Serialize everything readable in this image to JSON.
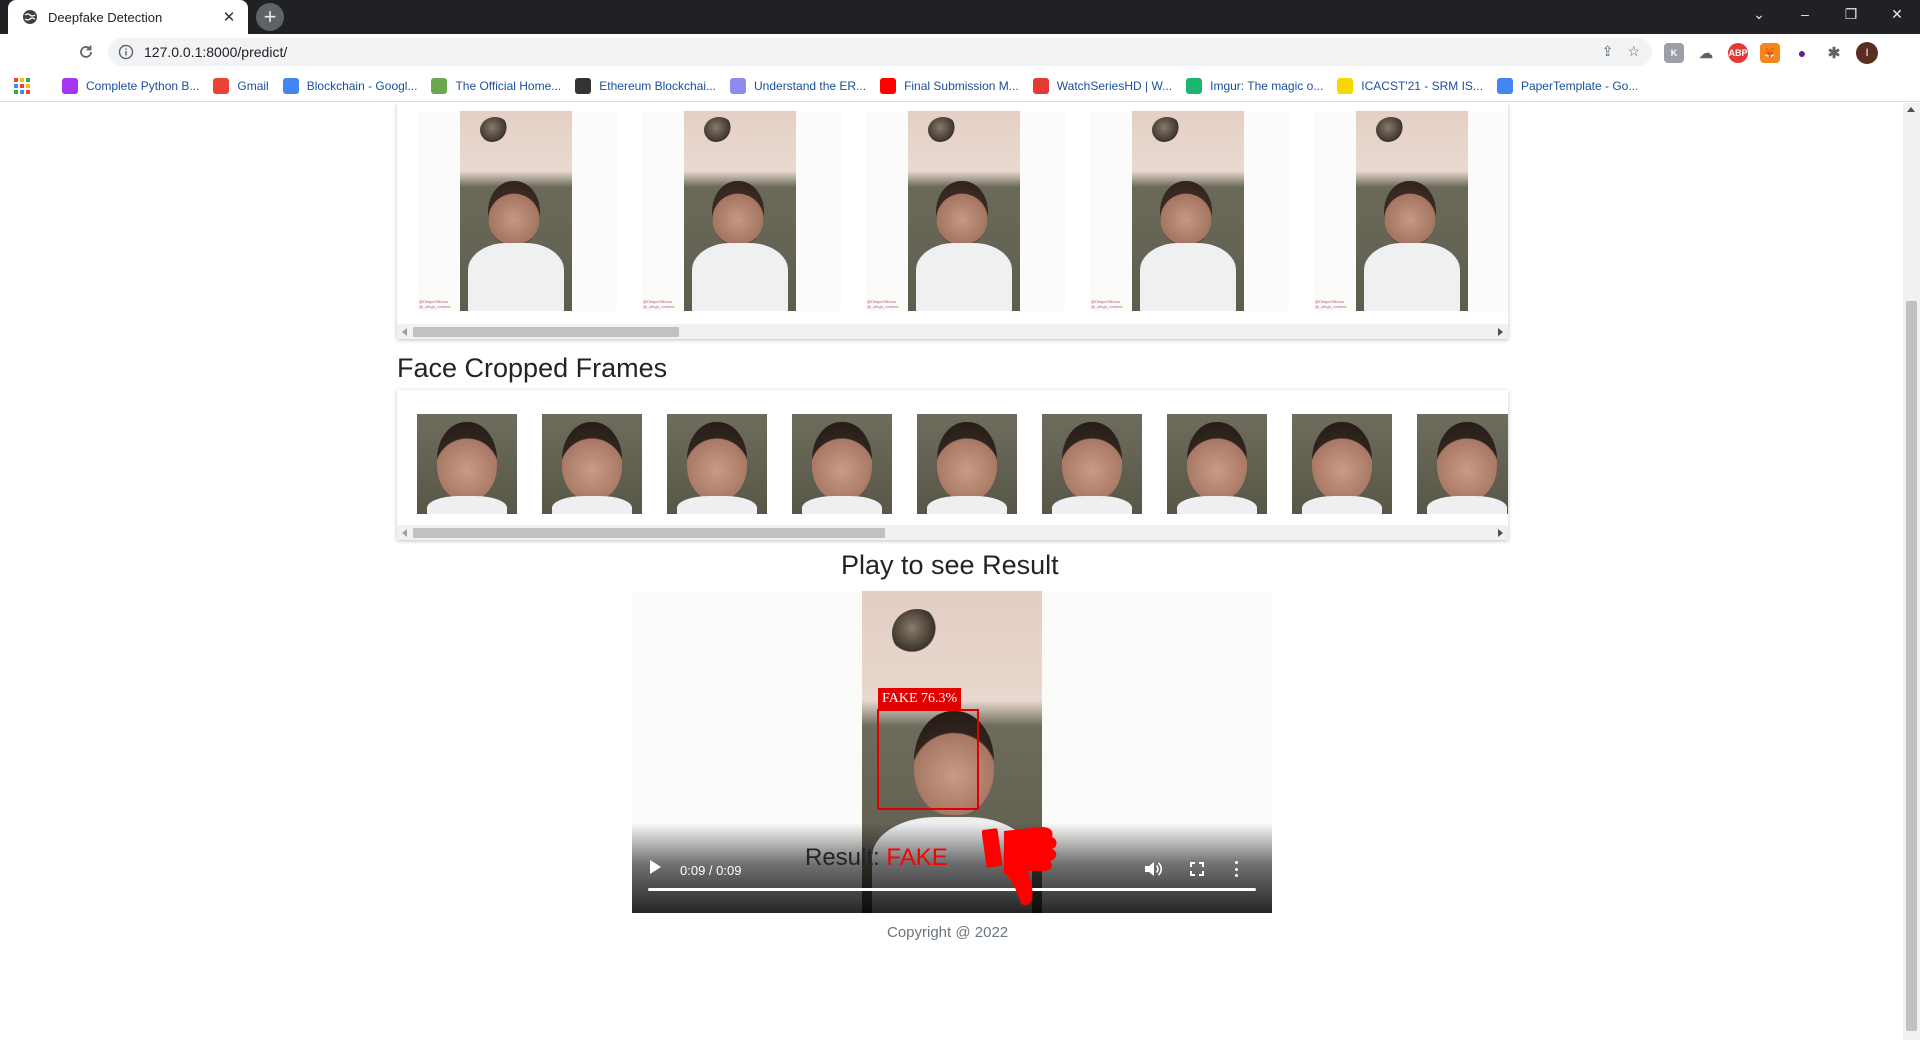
{
  "browser": {
    "tab_title": "Deepfake Detection",
    "url": "127.0.0.1:8000/predict/",
    "bookmarks": [
      {
        "label": "Complete Python B...",
        "icon": "udemy-icon",
        "color": "#a435f0"
      },
      {
        "label": "Gmail",
        "icon": "gmail-icon",
        "color": "#ea4335"
      },
      {
        "label": "Blockchain - Googl...",
        "icon": "google-docs-icon",
        "color": "#4285f4"
      },
      {
        "label": "The Official Home...",
        "icon": "site-icon",
        "color": "#6aa84f"
      },
      {
        "label": "Ethereum Blockchai...",
        "icon": "medium-icon",
        "color": "#333333"
      },
      {
        "label": "Understand the ER...",
        "icon": "ethereum-icon",
        "color": "#8c8cf0"
      },
      {
        "label": "Final Submission M...",
        "icon": "youtube-icon",
        "color": "#ff0000"
      },
      {
        "label": "WatchSeriesHD | W...",
        "icon": "play-circle-icon",
        "color": "#e53935"
      },
      {
        "label": "Imgur: The magic o...",
        "icon": "imgur-icon",
        "color": "#1bb76e"
      },
      {
        "label": "ICACST'21 - SRM IS...",
        "icon": "srm-icon",
        "color": "#f5d800"
      },
      {
        "label": "PaperTemplate - Go...",
        "icon": "google-docs-icon",
        "color": "#4285f4"
      }
    ],
    "profile_initial": "I"
  },
  "page": {
    "frames_count": 5,
    "frame_watermark": "@DiegoOffKens\n@_diego_rominor",
    "face_section_title": "Face Cropped Frames",
    "faces_count": 9,
    "video_title": "Play to see Result",
    "detection_label": "FAKE  76.3%",
    "video_time": "0:09 / 0:09",
    "result_label": "Result:",
    "result_value": "FAKE",
    "copyright": "Copyright @ 2022",
    "accent_red": "#ff0000"
  }
}
